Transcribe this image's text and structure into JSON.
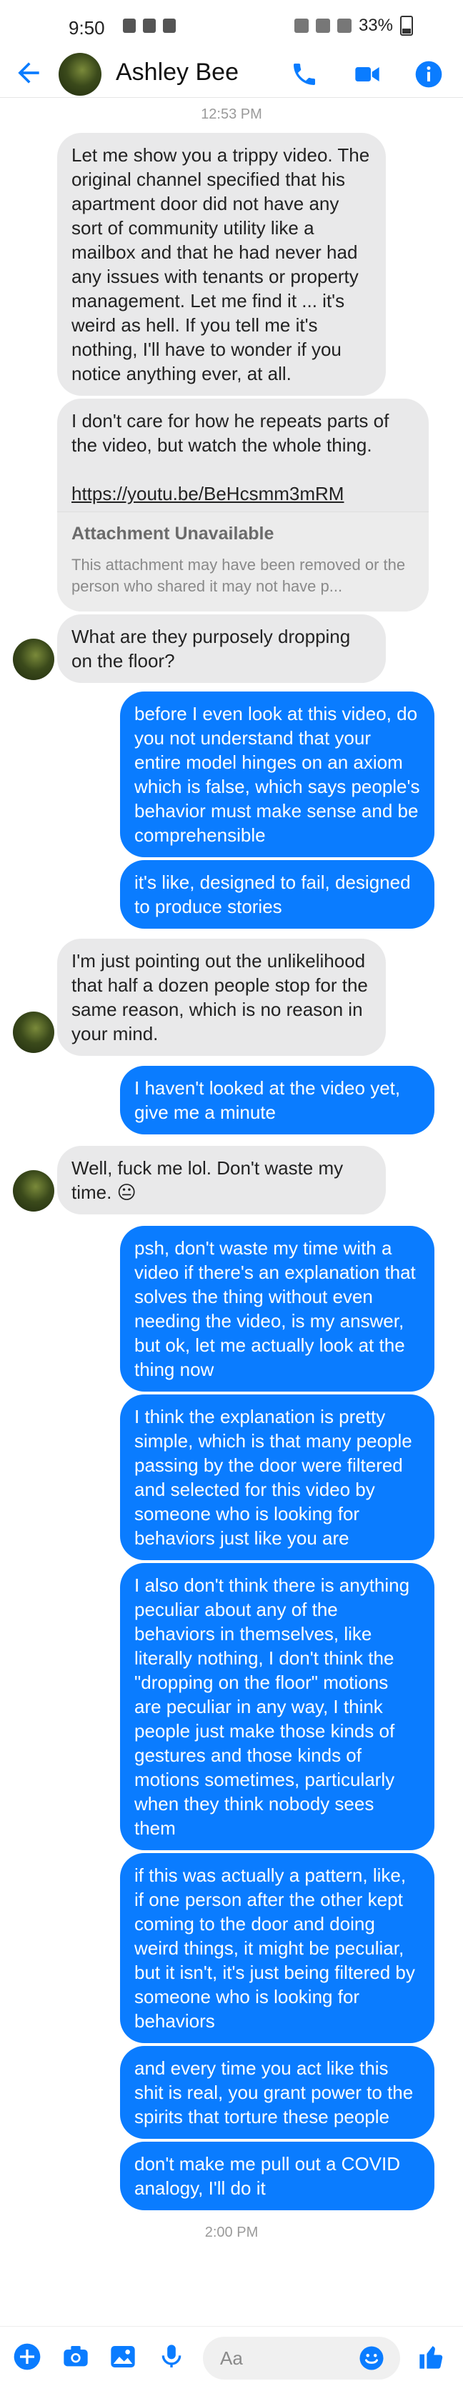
{
  "status_bar": {
    "time": "9:50",
    "battery": "33%"
  },
  "header": {
    "contact_name": "Ashley Bee"
  },
  "timestamps": {
    "first": "12:53 PM",
    "second": "2:00 PM"
  },
  "messages": [
    {
      "from": "them",
      "text": "Let me show you a trippy video. The original channel specified that his apartment door did not have any sort of community utility like a mailbox and that he had never had any issues with tenants or property management. Let me find it ... it's weird as hell. If you tell me it's nothing, I'll have to wonder if you notice anything ever, at all."
    },
    {
      "from": "them",
      "text": "I don't care for how he repeats parts of the video, but watch the whole thing.",
      "link": "https://youtu.be/BeHcsmm3mRM",
      "attachment_title": "Attachment Unavailable",
      "attachment_desc": "This attachment may have been removed or the person who shared it may not have p..."
    },
    {
      "from": "them",
      "text": "What are they purposely dropping on the floor?"
    },
    {
      "from": "me",
      "text": "before I even look at this video, do you not understand that your entire model hinges on an axiom which is false, which says people's behavior must make sense and be comprehensible"
    },
    {
      "from": "me",
      "text": "it's like, designed to fail, designed to produce stories"
    },
    {
      "from": "them",
      "text": "I'm just pointing out the unlikelihood that half a dozen people stop for the same reason, which is no reason in your mind."
    },
    {
      "from": "me",
      "text": "I haven't looked at the video yet, give me a minute"
    },
    {
      "from": "them",
      "text": "Well, fuck me lol. Don't waste my time. 😐"
    },
    {
      "from": "me",
      "text": "psh, don't waste my time with a video if there's an explanation that solves the thing without even needing the video, is my answer, but ok, let me actually look at the thing now"
    },
    {
      "from": "me",
      "text": "I think the explanation is pretty simple, which is that many people passing by the door were filtered and selected for this video by someone who is looking for behaviors just like you are"
    },
    {
      "from": "me",
      "text": "I also don't think there is anything peculiar about any of the behaviors in themselves, like literally nothing, I don't think the \"dropping on the floor\" motions are peculiar in any way, I think people just make those kinds of gestures and those kinds of motions sometimes, particularly when they think nobody sees them"
    },
    {
      "from": "me",
      "text": "if this was actually a pattern, like, if one person after the other kept coming to the door and doing weird things, it might be peculiar, but it isn't, it's just being filtered by someone who is looking for behaviors"
    },
    {
      "from": "me",
      "text": "and every time you act like this shit is real, you grant power to the spirits that torture these people"
    },
    {
      "from": "me",
      "text": "don't make me pull out a COVID analogy, I'll do it"
    }
  ],
  "composer": {
    "placeholder": "Aa"
  },
  "colors": {
    "accent": "#0a7cff",
    "incoming_bubble": "#e9e9ea",
    "outgoing_text": "#ffffff"
  },
  "icons": [
    "back-arrow-icon",
    "phone-icon",
    "video-camera-icon",
    "info-icon",
    "plus-icon",
    "camera-icon",
    "image-icon",
    "microphone-icon",
    "emoji-icon",
    "thumbs-up-icon"
  ]
}
